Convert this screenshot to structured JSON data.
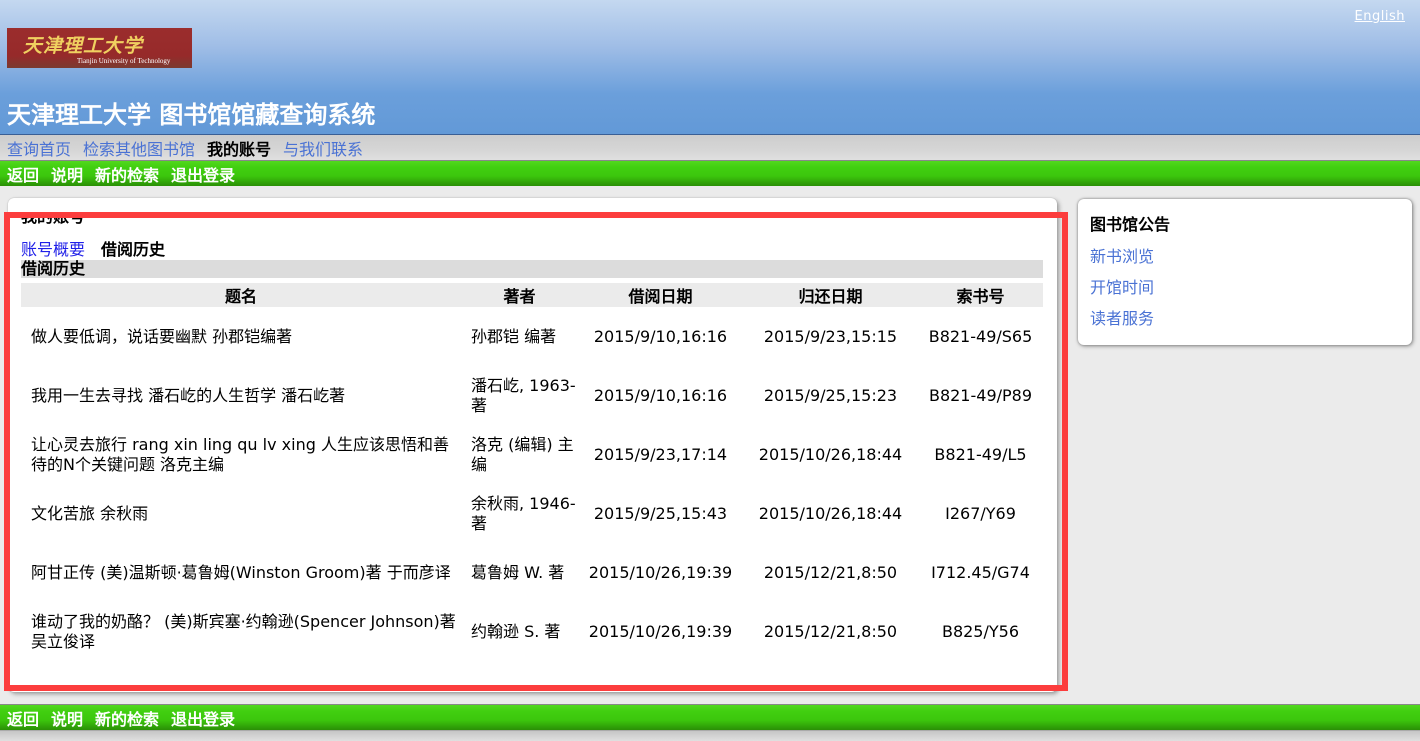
{
  "header": {
    "english_link": "English",
    "logo_cn": "天津理工大学",
    "logo_en": "Tianjin University of Technology",
    "site_title": "天津理工大学 图书馆馆藏查询系统"
  },
  "topnav": {
    "items": [
      {
        "label": "查询首页",
        "active": false
      },
      {
        "label": "检索其他图书馆",
        "active": false
      },
      {
        "label": "我的账号",
        "active": true
      },
      {
        "label": "与我们联系",
        "active": false
      }
    ]
  },
  "actionbar": {
    "items": [
      "返回",
      "说明",
      "新的检索",
      "退出登录"
    ]
  },
  "main": {
    "section_title": "我的账号",
    "subtabs": [
      {
        "label": "账号概要",
        "link": true
      },
      {
        "label": "借阅历史",
        "link": false
      }
    ],
    "group_header": "借阅历史",
    "table": {
      "columns": [
        "题名",
        "著者",
        "借阅日期",
        "归还日期",
        "索书号"
      ],
      "rows": [
        {
          "title": "做人要低调，说话要幽默 孙郡铠编著",
          "author": "孙郡铠 编著",
          "borrow": "2015/9/10,16:16",
          "return": "2015/9/23,15:15",
          "call": "B821-49/S65"
        },
        {
          "title": "我用一生去寻找 潘石屹的人生哲学 潘石屹著",
          "author": "潘石屹, 1963- 著",
          "borrow": "2015/9/10,16:16",
          "return": "2015/9/25,15:23",
          "call": "B821-49/P89"
        },
        {
          "title": "让心灵去旅行 rang xin ling qu lv xing 人生应该思悟和善待的N个关键问题 洛克主编",
          "author": "洛克 (编辑) 主编",
          "borrow": "2015/9/23,17:14",
          "return": "2015/10/26,18:44",
          "call": "B821-49/L5"
        },
        {
          "title": "文化苦旅 余秋雨",
          "author": "余秋雨, 1946- 著",
          "borrow": "2015/9/25,15:43",
          "return": "2015/10/26,18:44",
          "call": "I267/Y69"
        },
        {
          "title": "阿甘正传 (美)温斯顿·葛鲁姆(Winston Groom)著 于而彦译",
          "author": "葛鲁姆 W. 著",
          "borrow": "2015/10/26,19:39",
          "return": "2015/12/21,8:50",
          "call": "I712.45/G74"
        },
        {
          "title": "谁动了我的奶酪？ (美)斯宾塞·约翰逊(Spencer Johnson)著 吴立俊译",
          "author": "约翰逊 S. 著",
          "borrow": "2015/10/26,19:39",
          "return": "2015/12/21,8:50",
          "call": "B825/Y56"
        }
      ]
    }
  },
  "sidebar": {
    "title": "图书馆公告",
    "links": [
      "新书浏览",
      "开馆时间",
      "读者服务"
    ]
  },
  "colors": {
    "highlight_border": "#fc3d3d",
    "link_blue": "#4a72d4",
    "green_bar": "#3cc70d",
    "header_blue": "#6299d7"
  }
}
